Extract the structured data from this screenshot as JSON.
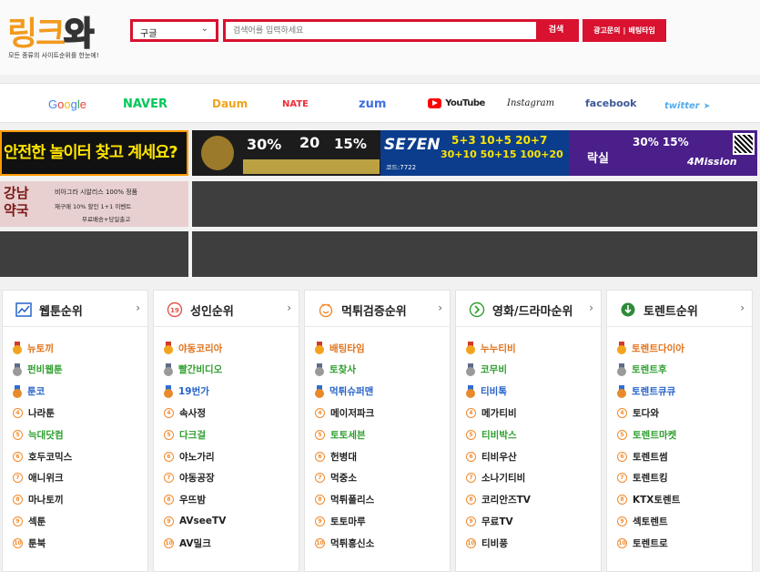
{
  "header": {
    "logo_a": "링크",
    "logo_b": "와",
    "tagline": "모든 종류의 사이트순위를 한눈에!",
    "engine_selected": "구글",
    "search_placeholder": "검색어를 입력하세요",
    "search_button": "검색",
    "ad_inquiry": "광고문의",
    "separator": "|",
    "betting_time": "배팅타임"
  },
  "portals": [
    {
      "label": "Google",
      "color": "#4285f4"
    },
    {
      "label": "NAVER",
      "color": "#03c75a"
    },
    {
      "label": "Daum",
      "color": "#f0a41c"
    },
    {
      "label": "NATE",
      "color": "#ee2c38"
    },
    {
      "label": "zum",
      "color": "#3f6fe0"
    },
    {
      "label": "YouTube",
      "color": "#222222"
    },
    {
      "label": "Instagram",
      "color": "#222222"
    },
    {
      "label": "facebook",
      "color": "#3b5998"
    },
    {
      "label": "twitter",
      "color": "#55acee"
    }
  ],
  "banners": {
    "b1": "안전한 놀이터 찾고 계세요?",
    "b2_pct1": "30%",
    "b2_num": "20",
    "b2_pct2": "15%",
    "b3_brand": "SE7EN",
    "b3_code": "코드:7722",
    "b3_odds": "5+3 10+5 20+7",
    "b3_odds2": "30+10 50+15 100+20",
    "b4_brand": "락실",
    "b4_odds": "30%  15%",
    "b4_mission": "4Mission",
    "b5_title": "강남 약국",
    "b5_line1": "비아그라 시알리스 100% 정품",
    "b5_line2": "재구매 10% 할인   1+1 이벤트",
    "b5_line3": "무료배송+당일출고"
  },
  "columns": [
    {
      "title": "웹툰순위",
      "icon": "chart-icon",
      "items": [
        {
          "label": "뉴토끼",
          "color": "#e0731a"
        },
        {
          "label": "펀비웹툰",
          "color": "#2f9e2f"
        },
        {
          "label": "툰코",
          "color": "#2663c9"
        },
        {
          "label": "나라툰",
          "color": "#222222"
        },
        {
          "label": "늑대닷컴",
          "color": "#2f9e2f"
        },
        {
          "label": "호두코믹스",
          "color": "#222222"
        },
        {
          "label": "애니위크",
          "color": "#222222"
        },
        {
          "label": "마나토끼",
          "color": "#222222"
        },
        {
          "label": "섹툰",
          "color": "#222222"
        },
        {
          "label": "툰북",
          "color": "#222222"
        }
      ]
    },
    {
      "title": "성인순위",
      "icon": "nineteen-icon",
      "items": [
        {
          "label": "야동코리아",
          "color": "#e0731a"
        },
        {
          "label": "빨간비디오",
          "color": "#2f9e2f"
        },
        {
          "label": "19번가",
          "color": "#2663c9"
        },
        {
          "label": "속사정",
          "color": "#222222"
        },
        {
          "label": "다크걸",
          "color": "#2f9e2f"
        },
        {
          "label": "야노가리",
          "color": "#222222"
        },
        {
          "label": "야동공장",
          "color": "#222222"
        },
        {
          "label": "우뜨밤",
          "color": "#222222"
        },
        {
          "label": "AVseeTV",
          "color": "#222222"
        },
        {
          "label": "AV밀크",
          "color": "#222222"
        }
      ]
    },
    {
      "title": "먹튀검증순위",
      "icon": "smile-icon",
      "items": [
        {
          "label": "배팅타임",
          "color": "#e0731a"
        },
        {
          "label": "토찾사",
          "color": "#2f9e2f"
        },
        {
          "label": "먹튀슈퍼맨",
          "color": "#2663c9"
        },
        {
          "label": "메이저파크",
          "color": "#222222"
        },
        {
          "label": "토토세븐",
          "color": "#2f9e2f"
        },
        {
          "label": "헌병대",
          "color": "#222222"
        },
        {
          "label": "먹중소",
          "color": "#222222"
        },
        {
          "label": "먹튀폴리스",
          "color": "#222222"
        },
        {
          "label": "토토마루",
          "color": "#222222"
        },
        {
          "label": "먹튀흥신소",
          "color": "#222222"
        }
      ]
    },
    {
      "title": "영화/드라마순위",
      "icon": "play-icon",
      "items": [
        {
          "label": "누누티비",
          "color": "#e0731a"
        },
        {
          "label": "코무비",
          "color": "#2f9e2f"
        },
        {
          "label": "티비톡",
          "color": "#2663c9"
        },
        {
          "label": "메가티비",
          "color": "#222222"
        },
        {
          "label": "티비박스",
          "color": "#2f9e2f"
        },
        {
          "label": "티비우산",
          "color": "#222222"
        },
        {
          "label": "소나기티비",
          "color": "#222222"
        },
        {
          "label": "코리안즈TV",
          "color": "#222222"
        },
        {
          "label": "무료TV",
          "color": "#222222"
        },
        {
          "label": "티비풍",
          "color": "#222222"
        }
      ]
    },
    {
      "title": "토렌트순위",
      "icon": "torrent-icon",
      "items": [
        {
          "label": "토렌트다이아",
          "color": "#e0731a"
        },
        {
          "label": "토렌트후",
          "color": "#2f9e2f"
        },
        {
          "label": "토렌트큐큐",
          "color": "#2663c9"
        },
        {
          "label": "토다와",
          "color": "#222222"
        },
        {
          "label": "토렌트마켓",
          "color": "#2f9e2f"
        },
        {
          "label": "토렌트썸",
          "color": "#222222"
        },
        {
          "label": "토렌트킹",
          "color": "#222222"
        },
        {
          "label": "KTX토렌트",
          "color": "#222222"
        },
        {
          "label": "섹토렌트",
          "color": "#222222"
        },
        {
          "label": "토렌트로",
          "color": "#222222"
        }
      ]
    }
  ]
}
